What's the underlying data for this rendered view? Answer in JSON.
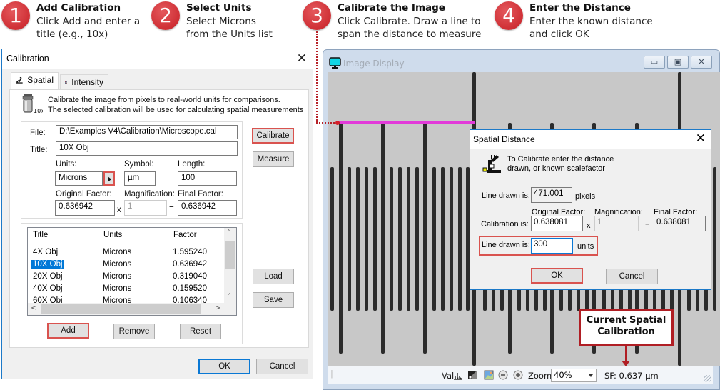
{
  "steps": [
    {
      "number": "1",
      "title": "Add Calibration",
      "lines": [
        "Click Add and enter a",
        "title (e.g., 10x)"
      ]
    },
    {
      "number": "2",
      "title": "Select Units",
      "lines": [
        "Select Microns",
        "from the Units list"
      ]
    },
    {
      "number": "3",
      "title": "Calibrate the Image",
      "lines": [
        "Click Calibrate. Draw a line to",
        "span the distance to measure"
      ]
    },
    {
      "number": "4",
      "title": "Enter the Distance",
      "lines": [
        "Enter the known distance",
        "and click OK"
      ]
    }
  ],
  "calibration_dialog": {
    "title": "Calibration",
    "close_icon": "close-icon",
    "tabs": [
      {
        "label": "Spatial",
        "icon": "microscope-icon",
        "active": true
      },
      {
        "label": "Intensity",
        "icon": "grid-icon",
        "active": false
      }
    ],
    "description": [
      "Calibrate the image from pixels to real-world units for comparisons.",
      "The selected calibration will be used for calculating spatial measurements"
    ],
    "objective_icon_label": "10×",
    "file_label": "File:",
    "file_value": "D:\\Examples V4\\Calibration\\Microscope.cal",
    "title_label": "Title:",
    "title_value": "10X Obj",
    "units_label": "Units:",
    "units_value": "Microns",
    "symbol_label": "Symbol:",
    "symbol_value": "µm",
    "length_label": "Length:",
    "length_value": "100",
    "original_factor_label": "Original Factor:",
    "original_factor_value": "0.636942",
    "magnification_label": "Magnification:",
    "magnification_value": "1",
    "final_factor_label": "Final Factor:",
    "final_factor_value": "0.636942",
    "times_sign": "x",
    "equals_sign": "=",
    "buttons": {
      "calibrate": "Calibrate",
      "measure": "Measure",
      "load": "Load",
      "save": "Save",
      "add": "Add",
      "remove": "Remove",
      "reset": "Reset",
      "ok": "OK",
      "cancel": "Cancel"
    },
    "list": {
      "columns": [
        "Title",
        "Units",
        "Factor"
      ],
      "rows": [
        {
          "title": "4X Obj",
          "units": "Microns",
          "factor": "1.595240",
          "selected": false
        },
        {
          "title": "10X Obj",
          "units": "Microns",
          "factor": "0.636942",
          "selected": true
        },
        {
          "title": "20X Obj",
          "units": "Microns",
          "factor": "0.319040",
          "selected": false
        },
        {
          "title": "40X Obj",
          "units": "Microns",
          "factor": "0.159520",
          "selected": false
        },
        {
          "title": "60X Obj",
          "units": "Microns",
          "factor": "0.106340",
          "selected": false
        }
      ]
    }
  },
  "image_display": {
    "title": "Image Display",
    "window_buttons": [
      "minimize",
      "maximize",
      "close"
    ],
    "status": {
      "values_label": "Val...",
      "zoom_label": "Zoom",
      "zoom_value": "40%",
      "scale_factor": "SF: 0.637 µm"
    }
  },
  "spatial_distance_dialog": {
    "title": "Spatial Distance",
    "message": [
      "To Calibrate enter the distance",
      "drawn, or known scalefactor"
    ],
    "line_drawn_label": "Line drawn is:",
    "line_drawn_pixels": "471.001",
    "pixels_unit": "pixels",
    "calibration_label": "Calibration is:",
    "original_factor_label": "Original Factor:",
    "original_factor_value": "0.638081",
    "magnification_label": "Magnification:",
    "magnification_value": "1",
    "final_factor_label": "Final Factor:",
    "final_factor_value": "0.638081",
    "times_sign": "x",
    "equals_sign": "=",
    "line_drawn_units_label": "Line drawn is:",
    "line_drawn_units_value": "300",
    "units_unit": "units",
    "ok": "OK",
    "cancel": "Cancel"
  },
  "annotation": {
    "lines": [
      "Current Spatial",
      "Calibration"
    ],
    "accent_color": "#b01e24"
  },
  "colors": {
    "step_badge": "#cf2f35",
    "highlight_red": "#d9534f",
    "selection_blue": "#0078d7",
    "measure_line": "#e23ad9"
  }
}
